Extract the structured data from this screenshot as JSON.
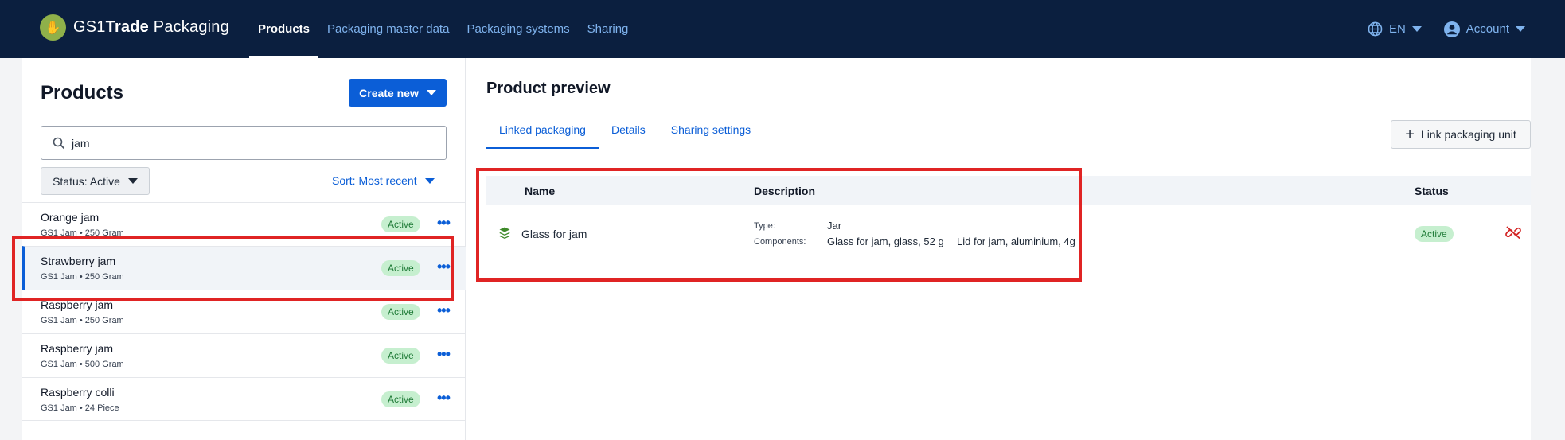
{
  "header": {
    "logo_mark": "✋",
    "brand_prefix": "GS1",
    "brand_bold": "Trade",
    "brand_suffix": " Packaging",
    "nav": [
      "Products",
      "Packaging master data",
      "Packaging systems",
      "Sharing"
    ],
    "language": "EN",
    "account": "Account"
  },
  "products_panel": {
    "title": "Products",
    "create_label": "Create new",
    "search_value": "jam",
    "status_filter": "Status: Active",
    "sort_label": "Sort: Most recent",
    "items": [
      {
        "name": "Orange jam",
        "sub": "GS1 Jam • 250 Gram",
        "status": "Active"
      },
      {
        "name": "Strawberry jam",
        "sub": "GS1 Jam • 250 Gram",
        "status": "Active"
      },
      {
        "name": "Raspberry jam",
        "sub": "GS1 Jam • 250 Gram",
        "status": "Active"
      },
      {
        "name": "Raspberry jam",
        "sub": "GS1 Jam • 500 Gram",
        "status": "Active"
      },
      {
        "name": "Raspberry colli",
        "sub": "GS1 Jam • 24 Piece",
        "status": "Active"
      }
    ],
    "more_glyph": "•••"
  },
  "preview": {
    "title": "Product preview",
    "tabs": [
      "Linked packaging",
      "Details",
      "Sharing settings"
    ],
    "link_button": "Link packaging unit",
    "columns": {
      "name": "Name",
      "description": "Description",
      "status": "Status"
    },
    "rows": [
      {
        "name": "Glass for jam",
        "type_label": "Type:",
        "type_value": "Jar",
        "components_label": "Components:",
        "components_value": "Glass for jam, glass, 52 g",
        "components_value2": "Lid for jam, aluminium, 4g",
        "status": "Active"
      }
    ]
  },
  "colors": {
    "navbar": "#0b1f3f",
    "accent": "#0b5ed7",
    "active_badge": "#c6efcf",
    "highlight": "#e02424"
  }
}
